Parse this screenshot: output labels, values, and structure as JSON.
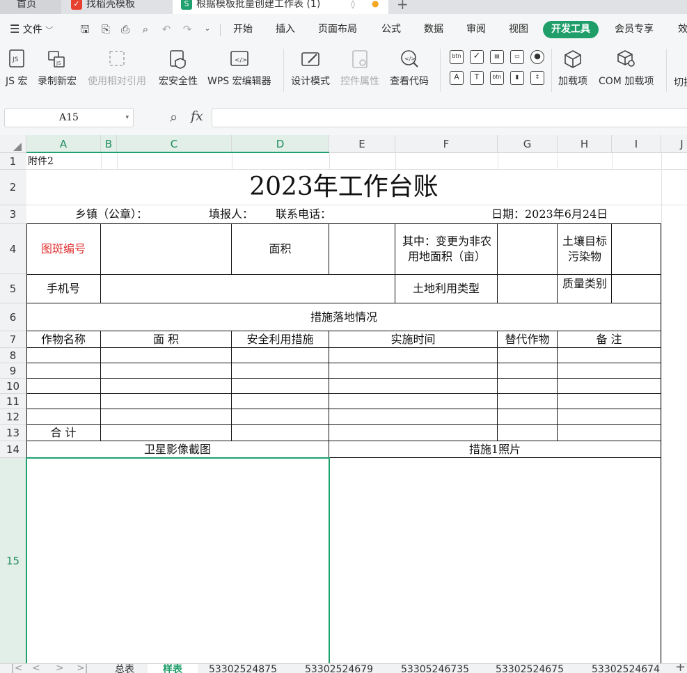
{
  "window_tabs": [
    {
      "label": "首页",
      "icon": "home-icon"
    },
    {
      "label": "找稻壳模板",
      "icon": "docer-icon"
    },
    {
      "label": "根据模板批量创建工作表 (1)",
      "icon": "spreadsheet-icon"
    }
  ],
  "menu": {
    "file": "文件",
    "tabs": [
      "开始",
      "插入",
      "页面布局",
      "公式",
      "数据",
      "审阅",
      "视图",
      "开发工具",
      "会员专享",
      "效"
    ],
    "active_tab": "开发工具"
  },
  "ribbon": {
    "js_macro": "JS 宏",
    "record_macro": "录制新宏",
    "relative_ref": "使用相对引用",
    "macro_security": "宏安全性",
    "wps_macro_editor": "WPS 宏编辑器",
    "design_mode": "设计模式",
    "control_props": "控件属性",
    "view_code": "查看代码",
    "addins": "加载项",
    "com_addins": "COM 加载项",
    "switch": "切换"
  },
  "formula_bar": {
    "name_box": "A15",
    "fx": "fx",
    "value": ""
  },
  "columns": [
    "A",
    "B",
    "C",
    "D",
    "E",
    "F",
    "G",
    "H",
    "I",
    "J"
  ],
  "rows": [
    "1",
    "2",
    "3",
    "4",
    "5",
    "6",
    "7",
    "8",
    "9",
    "10",
    "11",
    "12",
    "13",
    "14",
    "15"
  ],
  "sheet": {
    "attachment": "附件2",
    "title": "2023年工作台账",
    "town_label": "乡镇（公章）：",
    "filler_label": "填报人：",
    "phone_label": "联系电话：",
    "date_label": "日期：2023年6月24日",
    "patch_no": "图斑编号",
    "area": "面积",
    "changed_area": "其中：变更为非农用地面积（亩）",
    "soil_target": "土壤目标污染物",
    "mobile": "手机号",
    "land_use_type": "土地利用类型",
    "quality_class": "质量类别",
    "measures_status": "措施落地情况",
    "headers": [
      "作物名称",
      "面 积",
      "安全利用措施",
      "实施时间",
      "替代作物",
      "备 注"
    ],
    "total": "合 计",
    "satellite": "卫星影像截图",
    "photo1": "措施1照片",
    "colors": {
      "patch_no": "#e03030"
    }
  },
  "sheet_tabs": [
    "总表",
    "样表",
    "53302524875",
    "53302524679",
    "53305246735",
    "53302524675",
    "53302524674"
  ],
  "active_sheet": "样表"
}
